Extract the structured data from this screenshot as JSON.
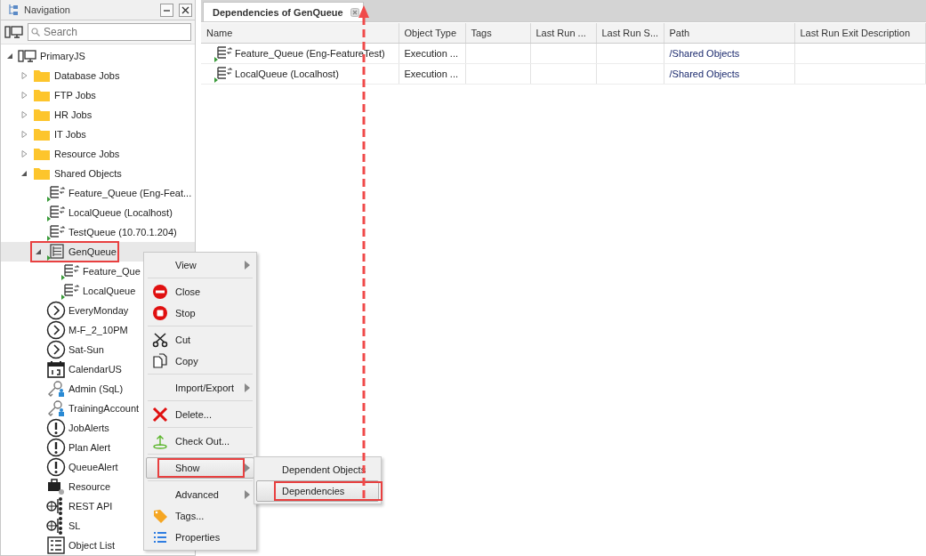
{
  "navigation": {
    "title": "Navigation",
    "search": {
      "placeholder": "Search"
    },
    "tree": [
      {
        "label": "PrimaryJS",
        "kind": "server",
        "expanded": true,
        "selected": false,
        "children": [
          {
            "label": "Database Jobs",
            "kind": "folder",
            "expanded": false,
            "selected": false
          },
          {
            "label": "FTP Jobs",
            "kind": "folder",
            "expanded": false,
            "selected": false
          },
          {
            "label": "HR Jobs",
            "kind": "folder",
            "expanded": false,
            "selected": false
          },
          {
            "label": "IT Jobs",
            "kind": "folder",
            "expanded": false,
            "selected": false
          },
          {
            "label": "Resource Jobs",
            "kind": "folder",
            "expanded": false,
            "selected": false
          },
          {
            "label": "Shared Objects",
            "kind": "folder",
            "expanded": true,
            "selected": false,
            "children": [
              {
                "label": "Feature_Queue (Eng-Feat...",
                "kind": "queue",
                "selected": false
              },
              {
                "label": "LocalQueue (Localhost)",
                "kind": "queue",
                "selected": false
              },
              {
                "label": "TestQueue (10.70.1.204)",
                "kind": "queue",
                "selected": false
              },
              {
                "label": "GenQueue",
                "kind": "group",
                "expanded": true,
                "selected": true,
                "annotated": true,
                "children": [
                  {
                    "label": "Feature_Que",
                    "kind": "queue",
                    "selected": false
                  },
                  {
                    "label": "LocalQueue",
                    "kind": "queue",
                    "selected": false
                  }
                ]
              },
              {
                "label": "EveryMonday",
                "kind": "schedule",
                "selected": false
              },
              {
                "label": "M-F_2_10PM",
                "kind": "schedule",
                "selected": false
              },
              {
                "label": "Sat-Sun",
                "kind": "schedule",
                "selected": false
              },
              {
                "label": "CalendarUS",
                "kind": "calendar",
                "selected": false
              },
              {
                "label": "Admin (SqL)",
                "kind": "credential",
                "selected": false
              },
              {
                "label": "TrainingAccount",
                "kind": "credential",
                "selected": false
              },
              {
                "label": "JobAlerts",
                "kind": "alert",
                "selected": false
              },
              {
                "label": "Plan Alert",
                "kind": "alert",
                "selected": false
              },
              {
                "label": "QueueAlert",
                "kind": "alert",
                "selected": false
              },
              {
                "label": "Resource",
                "kind": "resource",
                "selected": false
              },
              {
                "label": "REST API",
                "kind": "webservice",
                "selected": false
              },
              {
                "label": "SL",
                "kind": "webservice",
                "selected": false
              },
              {
                "label": "Object List",
                "kind": "list",
                "selected": false
              }
            ]
          }
        ]
      }
    ]
  },
  "tab": {
    "title": "Dependencies of GenQueue",
    "selected": true
  },
  "table": {
    "columns": [
      "Name",
      "Object Type",
      "Tags",
      "Last Run ...",
      "Last Run S...",
      "Path",
      "Last Run Exit Description"
    ],
    "rows": [
      {
        "name": "Feature_Queue (Eng-FeatureTest)",
        "object_type": "Execution ...",
        "path": "/Shared Objects"
      },
      {
        "name": "LocalQueue (Localhost)",
        "object_type": "Execution ...",
        "path": "/Shared Objects"
      }
    ]
  },
  "context_menu": {
    "groups": [
      [
        {
          "label": "View",
          "submenu": true,
          "selected": false
        }
      ],
      [
        {
          "label": "Close",
          "kind": "close",
          "selected": false
        },
        {
          "label": "Stop",
          "kind": "stop",
          "selected": false
        }
      ],
      [
        {
          "label": "Cut",
          "kind": "cut",
          "selected": false
        },
        {
          "label": "Copy",
          "kind": "copy",
          "selected": false
        }
      ],
      [
        {
          "label": "Import/Export",
          "submenu": true,
          "selected": false
        }
      ],
      [
        {
          "label": "Delete...",
          "kind": "delete",
          "selected": false
        }
      ],
      [
        {
          "label": "Check Out...",
          "kind": "checkout",
          "selected": false
        }
      ],
      [
        {
          "label": "Show",
          "submenu": true,
          "selected": true,
          "annotated": true
        }
      ],
      [
        {
          "label": "Advanced",
          "submenu": true,
          "selected": false
        },
        {
          "label": "Tags...",
          "kind": "tag",
          "selected": false
        },
        {
          "label": "Properties",
          "kind": "properties",
          "selected": false
        }
      ]
    ],
    "submenu": [
      {
        "label": "Dependent Objects",
        "selected": false
      },
      {
        "label": "Dependencies",
        "selected": true,
        "annotated": true
      }
    ]
  }
}
